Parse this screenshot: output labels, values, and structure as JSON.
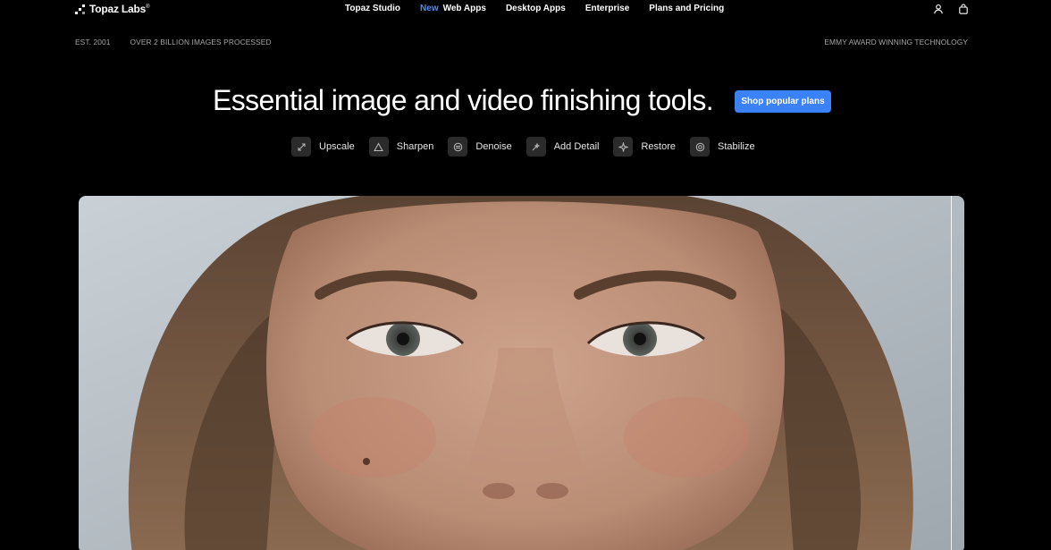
{
  "brand": {
    "name": "Topaz Labs",
    "mark": "®"
  },
  "nav": {
    "items": [
      {
        "label": "Topaz Studio"
      },
      {
        "badge": "New",
        "label": "Web Apps"
      },
      {
        "label": "Desktop Apps"
      },
      {
        "label": "Enterprise"
      },
      {
        "label": "Plans and Pricing"
      }
    ],
    "icons": [
      "user-icon",
      "cart-icon"
    ]
  },
  "info": {
    "established": "EST. 2001",
    "processed": "OVER 2 BILLION IMAGES PROCESSED",
    "award": "EMMY AWARD WINNING TECHNOLOGY"
  },
  "hero": {
    "title": "Essential image and video finishing tools.",
    "cta": "Shop popular plans"
  },
  "tools": [
    {
      "label": "Upscale",
      "icon": "upscale-icon"
    },
    {
      "label": "Sharpen",
      "icon": "sharpen-icon"
    },
    {
      "label": "Denoise",
      "icon": "denoise-icon"
    },
    {
      "label": "Add Detail",
      "icon": "add-detail-icon"
    },
    {
      "label": "Restore",
      "icon": "restore-icon"
    },
    {
      "label": "Stabilize",
      "icon": "stabilize-icon"
    }
  ],
  "colors": {
    "background": "#000000",
    "accent": "#3b82f6",
    "new_badge": "#4f8df7",
    "tool_icon_bg": "#2b2b2b"
  }
}
